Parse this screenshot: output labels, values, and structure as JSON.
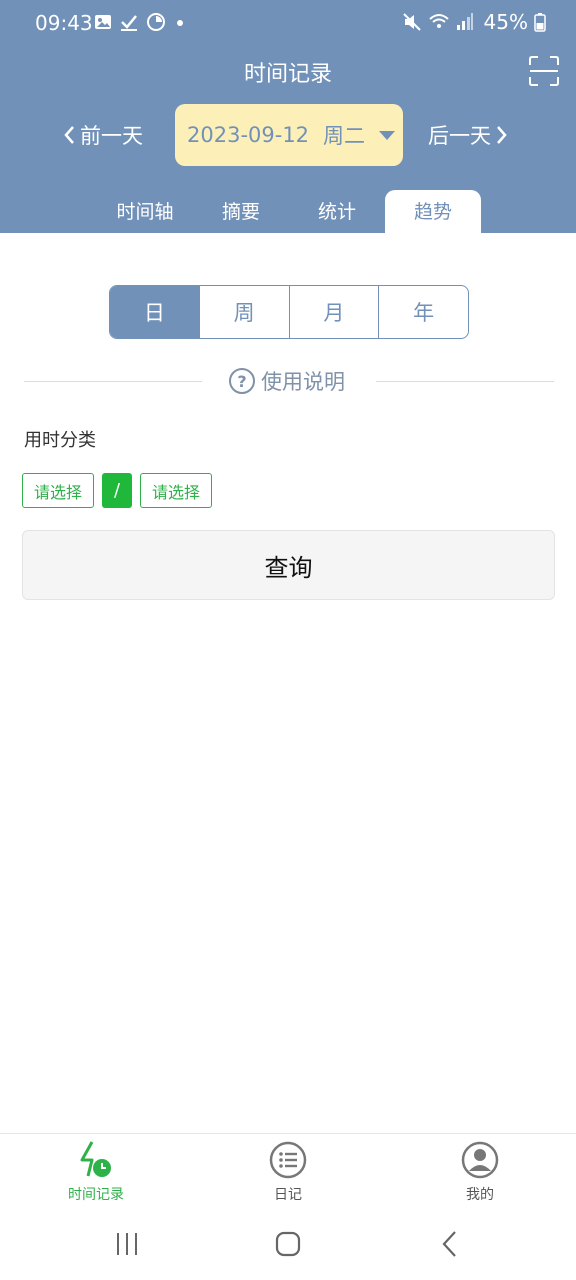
{
  "status_bar": {
    "time": "09:43",
    "battery": "45%"
  },
  "header": {
    "title": "时间记录",
    "prev_day": "前一天",
    "next_day": "后一天",
    "date": "2023-09-12",
    "weekday": "周二",
    "background_color": "#7291b8",
    "date_pill_color": "#fcf0b8"
  },
  "tabs": [
    {
      "label": "时间轴",
      "active": false
    },
    {
      "label": "摘要",
      "active": false
    },
    {
      "label": "统计",
      "active": false
    },
    {
      "label": "趋势",
      "active": true
    }
  ],
  "period_selector": {
    "options": [
      "日",
      "周",
      "月",
      "年"
    ],
    "selected": "日"
  },
  "help": {
    "label": "使用说明"
  },
  "category": {
    "label": "用时分类",
    "first_placeholder": "请选择",
    "separator": "/",
    "second_placeholder": "请选择",
    "accent_color": "#2fb14a"
  },
  "query_button": {
    "label": "查询"
  },
  "bottom_nav": [
    {
      "label": "时间记录",
      "icon": "time-record-icon",
      "active": true
    },
    {
      "label": "日记",
      "icon": "list-icon",
      "active": false
    },
    {
      "label": "我的",
      "icon": "user-icon",
      "active": false
    }
  ]
}
